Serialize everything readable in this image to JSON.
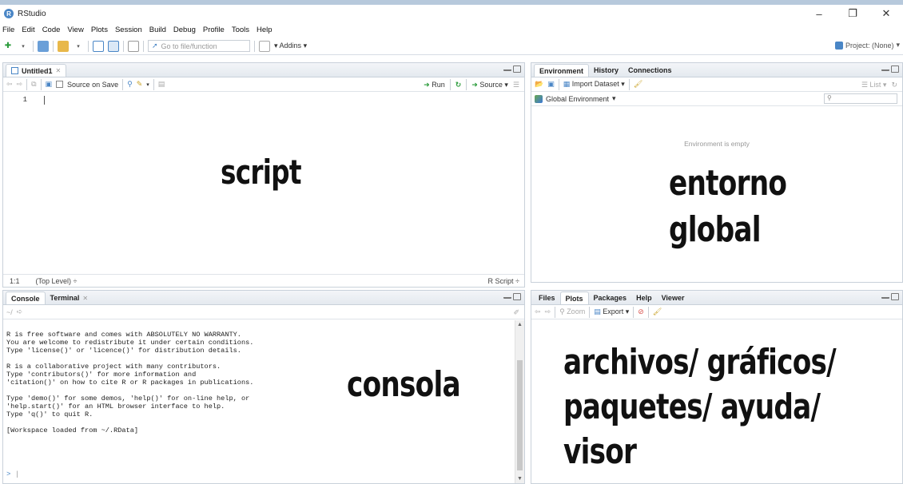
{
  "window": {
    "title": "RStudio",
    "controls": {
      "minimize": "–",
      "maximize": "❐",
      "close": "✕"
    }
  },
  "menu": [
    "File",
    "Edit",
    "Code",
    "View",
    "Plots",
    "Session",
    "Build",
    "Debug",
    "Profile",
    "Tools",
    "Help"
  ],
  "toolbar": {
    "goto_placeholder": "Go to file/function",
    "addins_label": "Addins",
    "project_label": "Project: (None)"
  },
  "source_pane": {
    "tab_label": "Untitled1",
    "source_on_save_label": "Source on Save",
    "run_label": "Run",
    "source_label": "Source",
    "line_number": "1",
    "status_position": "1:1",
    "status_scope": "(Top Level) ÷",
    "status_filetype": "R Script ÷",
    "overlay_label": "script"
  },
  "console_pane": {
    "tabs": [
      "Console",
      "Terminal"
    ],
    "path": "~/",
    "lines": [
      "R is free software and comes with ABSOLUTELY NO WARRANTY.",
      "You are welcome to redistribute it under certain conditions.",
      "Type 'license()' or 'licence()' for distribution details.",
      "",
      "R is a collaborative project with many contributors.",
      "Type 'contributors()' for more information and",
      "'citation()' on how to cite R or R packages in publications.",
      "",
      "Type 'demo()' for some demos, 'help()' for on-line help, or",
      "'help.start()' for an HTML browser interface to help.",
      "Type 'q()' to quit R.",
      "",
      "[Workspace loaded from ~/.RData]"
    ],
    "prompt": ">",
    "overlay_label": "consola"
  },
  "env_pane": {
    "tabs": [
      "Environment",
      "History",
      "Connections"
    ],
    "import_label": "Import Dataset",
    "list_label": "List",
    "global_env_label": "Global Environment",
    "empty_message": "Environment is empty",
    "overlay_line1": "entorno",
    "overlay_line2": "global"
  },
  "files_pane": {
    "tabs": [
      "Files",
      "Plots",
      "Packages",
      "Help",
      "Viewer"
    ],
    "zoom_label": "Zoom",
    "export_label": "Export",
    "overlay_line1": "archivos/ gráficos/",
    "overlay_line2": "paquetes/ ayuda/",
    "overlay_line3": "visor"
  }
}
